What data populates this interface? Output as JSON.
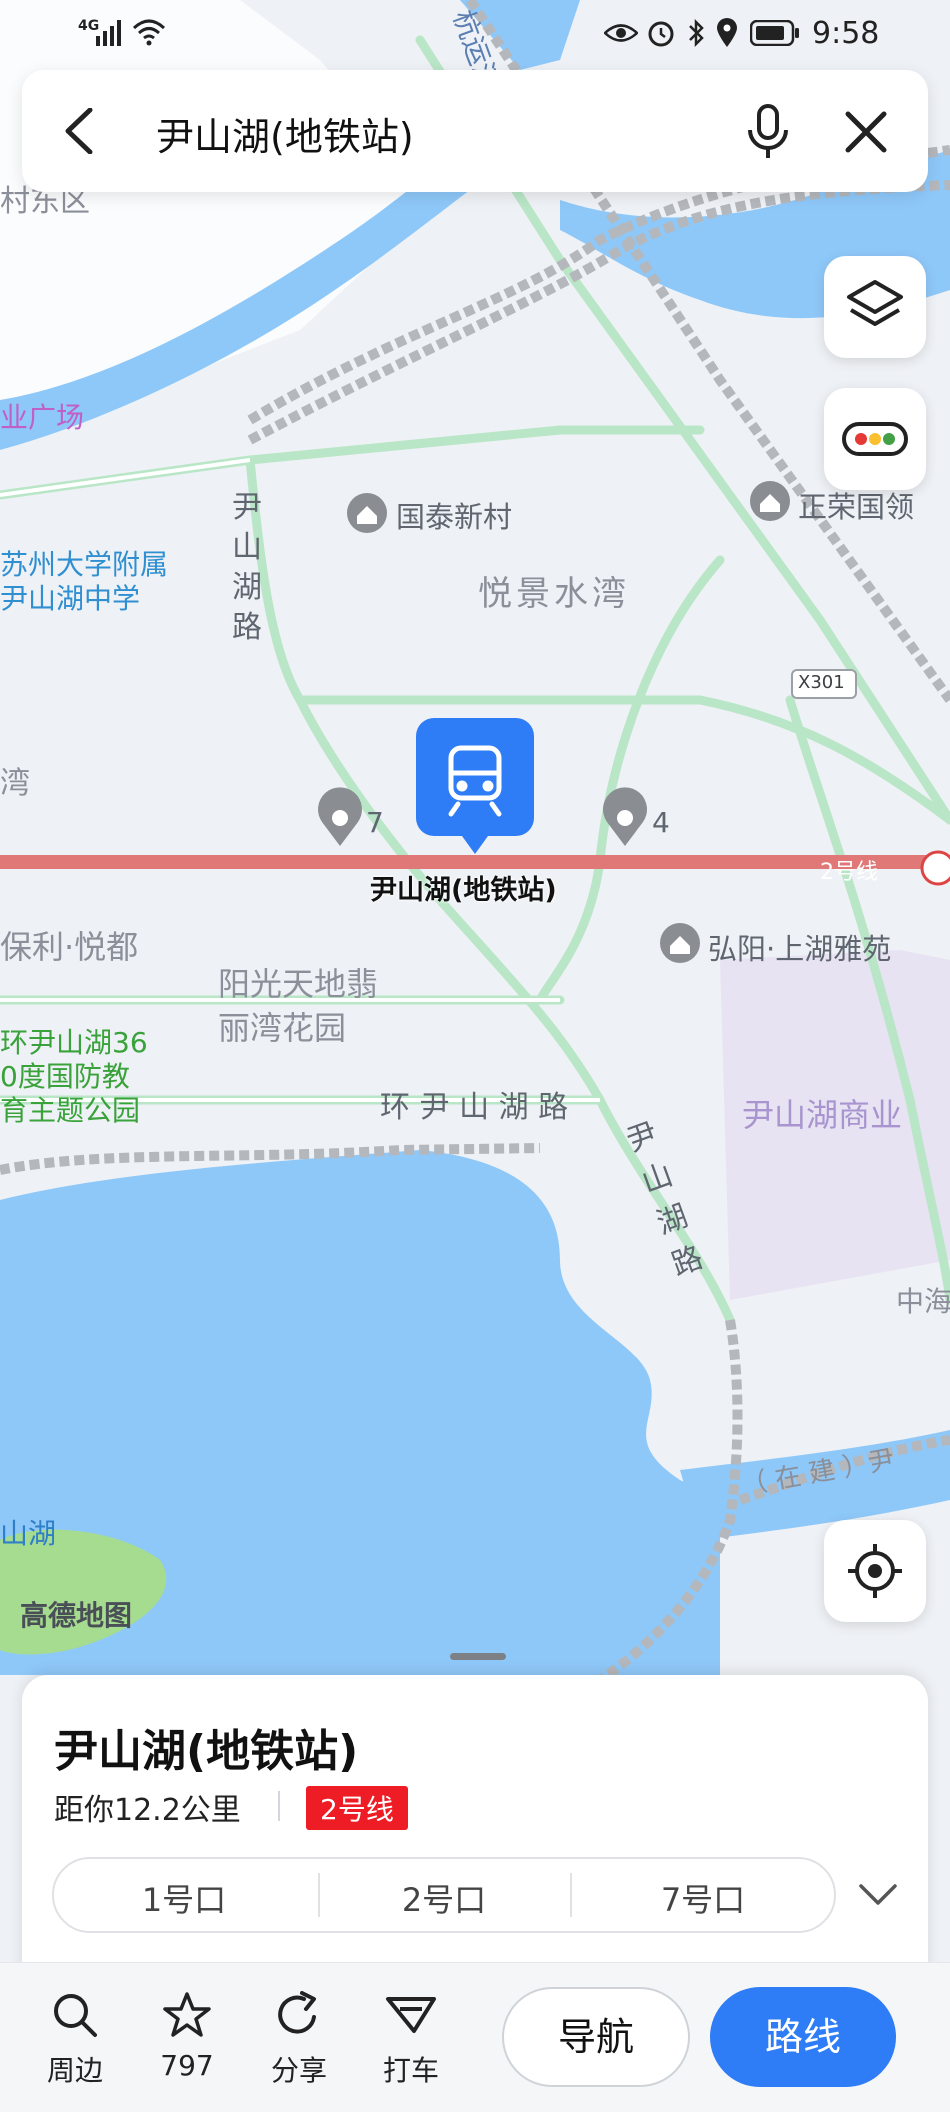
{
  "status_bar": {
    "network": "4G",
    "time": "9:58"
  },
  "search": {
    "query": "尹山湖(地铁站)"
  },
  "map": {
    "station_label": "尹山湖(地铁站)",
    "line_tag": "2号线",
    "watermark": "高德地图",
    "labels": {
      "canal": "杭运河",
      "cun_dong": "村东区",
      "ye_guangchang": "业广场",
      "guotai": "国泰新村",
      "zhengrong": "正荣国领",
      "yuejing": "悦景水湾",
      "suzhou_school": "苏州大学附属\n尹山湖中学",
      "yinshanhu_road_v1": "尹\n山\n湖\n路",
      "x301": "X301",
      "wan": "湾",
      "exit_7": "7",
      "exit_4": "4",
      "baoli": "保利·悦都",
      "hongyang": "弘阳·上湖雅苑",
      "yangguang": "阳光天地翡\n丽湾花园",
      "park": "环尹山湖36\n0度国防教\n育主题公园",
      "huan_road": "环 尹 山 湖 路",
      "yinshanhu_road_v2": "尹\n山\n湖\n路",
      "commercial": "尹山湖商业",
      "zhonghai": "中海",
      "zaijian": "（ 在 建 ）尹",
      "lake": "山湖"
    }
  },
  "card": {
    "title": "尹山湖(地铁站)",
    "distance": "距你12.2公里",
    "line_badge": "2号线",
    "line_color": "#ee1c25",
    "exits": [
      "1号口",
      "2号口",
      "7号口"
    ]
  },
  "bottom_bar": {
    "nearby": "周边",
    "favorites": "797",
    "share": "分享",
    "taxi": "打车",
    "navigate": "导航",
    "route": "路线"
  },
  "colors": {
    "accent": "#2e7cf6",
    "water": "#8ec8f9",
    "park": "#a5dc8f",
    "metro": "#e07878"
  }
}
